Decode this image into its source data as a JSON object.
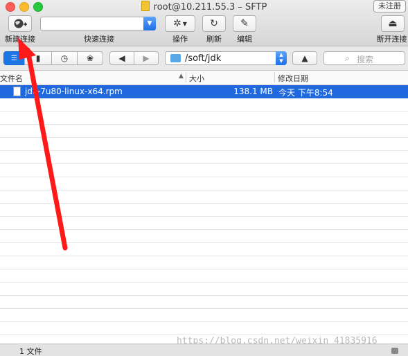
{
  "window": {
    "title": "root@10.211.55.3 – SFTP",
    "unregistered_label": "未注册"
  },
  "toolbar": {
    "new_connection_label": "新建连接",
    "quick_connect_label": "快速连接",
    "quick_connect_value": "",
    "action_label": "操作",
    "refresh_label": "刷新",
    "edit_label": "编辑",
    "disconnect_label": "断开连接"
  },
  "pathbar": {
    "current_path": "/soft/jdk",
    "search_placeholder": "搜索"
  },
  "columns": {
    "name": "文件名",
    "size": "大小",
    "modified": "修改日期"
  },
  "files": [
    {
      "name": "jdk-7u80-linux-x64.rpm",
      "size": "138.1 MB",
      "modified": "今天 下午8:54",
      "selected": true
    }
  ],
  "status": {
    "count": "1 文件"
  },
  "watermark": "https://blog.csdn.net/weixin_41835916",
  "colors": {
    "selection": "#1f68dd",
    "annotation_arrow": "#ff1a1a",
    "accent": "#1d75e6"
  }
}
